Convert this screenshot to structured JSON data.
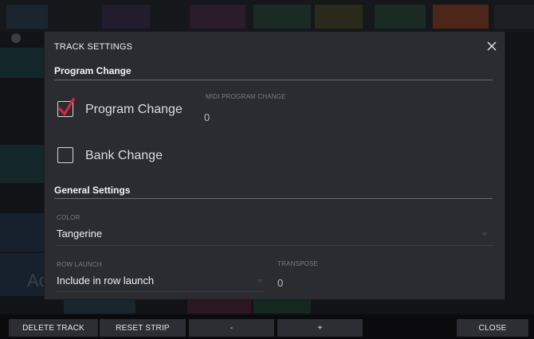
{
  "modal": {
    "title": "TRACK SETTINGS",
    "close_icon": "close-icon"
  },
  "program_change_section": {
    "title": "Program Change",
    "program_change": {
      "label": "Program Change",
      "checked": true,
      "check_color": "#e0213e"
    },
    "midi_program_change": {
      "label": "MIDI PROGRAM CHANGE",
      "value": "0"
    },
    "bank_change": {
      "label": "Bank Change",
      "checked": false
    }
  },
  "general_section": {
    "title": "General Settings",
    "color": {
      "label": "COLOR",
      "value": "Tangerine"
    },
    "row_launch": {
      "label": "ROW LAUNCH",
      "value": "Include in row launch"
    },
    "transpose": {
      "label": "TRANSPOSE",
      "value": "0"
    }
  },
  "toolbar": {
    "delete_track": "DELETE TRACK",
    "reset_strip": "RESET STRIP",
    "minus": "-",
    "plus": "+",
    "close": "CLOSE"
  },
  "colors": {
    "accent": "#e0213e",
    "modal_bg": "#2b2c31",
    "button_bg": "#2d2e33"
  }
}
